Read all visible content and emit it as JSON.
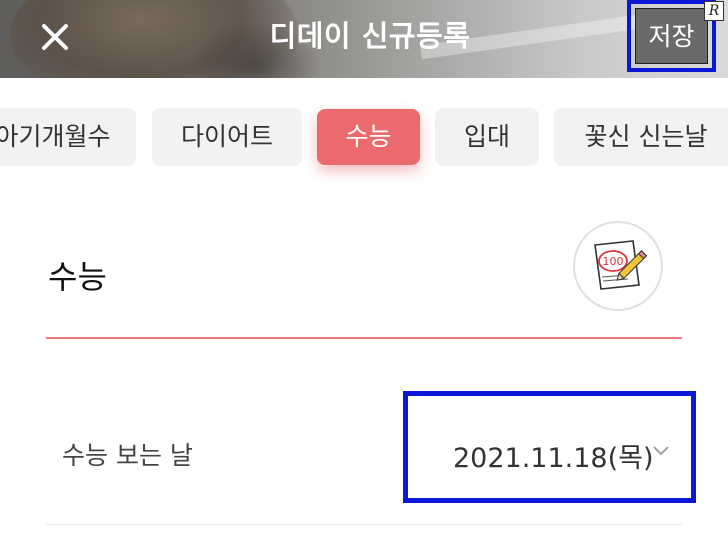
{
  "header": {
    "title": "디데이 신규등록",
    "save_label": "저장",
    "corner_mark": "R",
    "close_icon": "close-icon"
  },
  "categories": [
    {
      "label": "아기개월수",
      "active": false
    },
    {
      "label": "다이어트",
      "active": false
    },
    {
      "label": "수능",
      "active": true
    },
    {
      "label": "입대",
      "active": false
    },
    {
      "label": "꽃신 신는날",
      "active": false
    }
  ],
  "section": {
    "title": "수능",
    "icon": "exam-paper-icon",
    "icon_text": "100"
  },
  "date_row": {
    "label": "수능 보는 날",
    "value": "2021.11.18(목)"
  },
  "colors": {
    "accent": "#ea6a6d",
    "highlight_box": "#0a18d6",
    "chip_bg": "#f2f2f2"
  }
}
